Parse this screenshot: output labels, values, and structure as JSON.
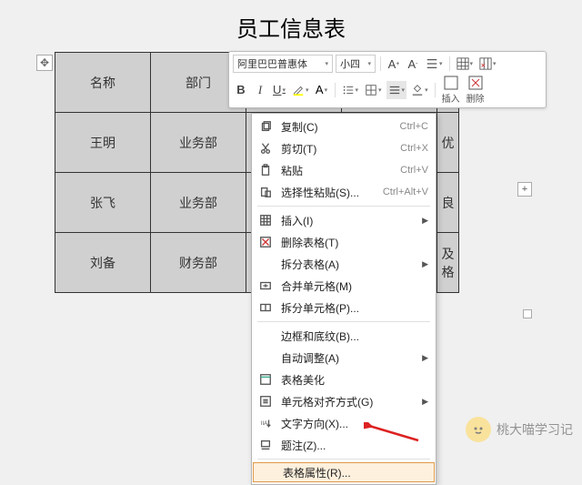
{
  "title": "员工信息表",
  "table": {
    "headers": [
      "名称",
      "部门"
    ],
    "rows": [
      {
        "name": "王明",
        "dept": "业务部",
        "tail": "优"
      },
      {
        "name": "张飞",
        "dept": "业务部",
        "tail": "良"
      },
      {
        "name": "刘备",
        "dept": "财务部",
        "tail": "及格"
      }
    ]
  },
  "toolbar": {
    "font_name": "阿里巴巴普惠体",
    "font_size": "小四",
    "insert_label": "插入",
    "delete_label": "删除"
  },
  "menu": {
    "copy": "复制(C)",
    "cut": "剪切(T)",
    "paste": "粘贴",
    "paste_special": "选择性粘贴(S)...",
    "insert": "插入(I)",
    "delete_table": "删除表格(T)",
    "split_table": "拆分表格(A)",
    "merge_cells": "合并单元格(M)",
    "split_cells": "拆分单元格(P)...",
    "borders": "边框和底纹(B)...",
    "autofit": "自动调整(A)",
    "beautify": "表格美化",
    "cell_align": "单元格对齐方式(G)",
    "text_dir": "文字方向(X)...",
    "caption": "题注(Z)...",
    "table_props": "表格属性(R)...",
    "sc_copy": "Ctrl+C",
    "sc_cut": "Ctrl+X",
    "sc_paste": "Ctrl+V",
    "sc_paste_special": "Ctrl+Alt+V"
  },
  "watermark": "桃大喵学习记"
}
